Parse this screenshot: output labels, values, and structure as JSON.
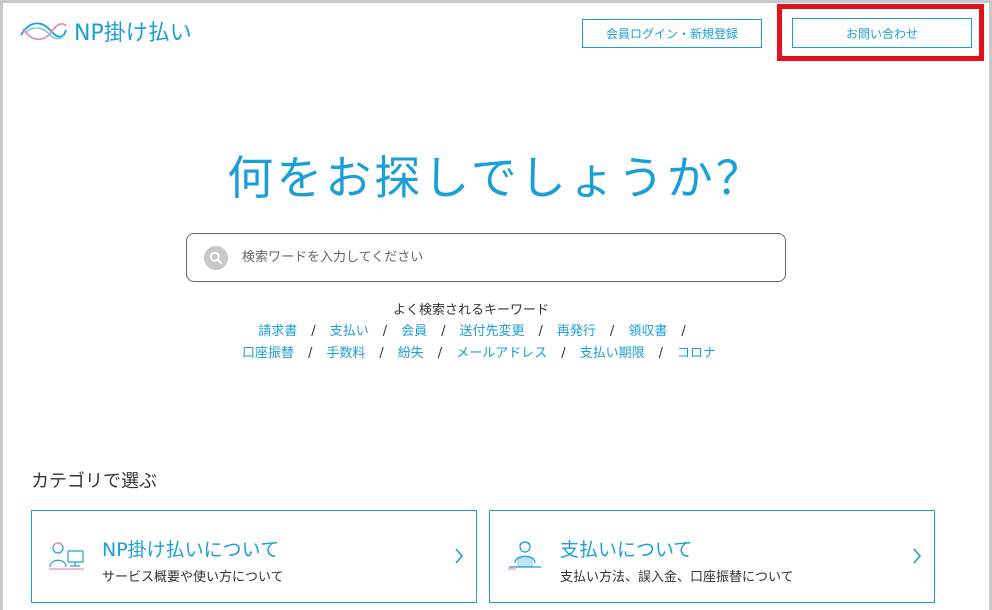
{
  "header": {
    "logo_text": "NP掛け払い",
    "login_label": "会員ログイン・新規登録",
    "contact_label": "お問い合わせ"
  },
  "hero": {
    "title": "何をお探しでしょうか？"
  },
  "search": {
    "placeholder": "検索ワードを入力してください"
  },
  "keywords": {
    "title": "よく検索されるキーワード",
    "row1": [
      "請求書",
      "支払い",
      "会員",
      "送付先変更",
      "再発行",
      "領収書"
    ],
    "row2": [
      "口座振替",
      "手数料",
      "紛失",
      "メールアドレス",
      "支払い期限",
      "コロナ"
    ]
  },
  "categories": {
    "title": "カテゴリで選ぶ",
    "items": [
      {
        "title": "NP掛け払いについて",
        "desc": "サービス概要や使い方について",
        "icon": "person-computer-icon"
      },
      {
        "title": "支払いについて",
        "desc": "支払い方法、誤入金、口座振替について",
        "icon": "person-payment-icon"
      }
    ]
  },
  "colors": {
    "accent": "#1a9fd8",
    "highlight": "#e3101e"
  }
}
